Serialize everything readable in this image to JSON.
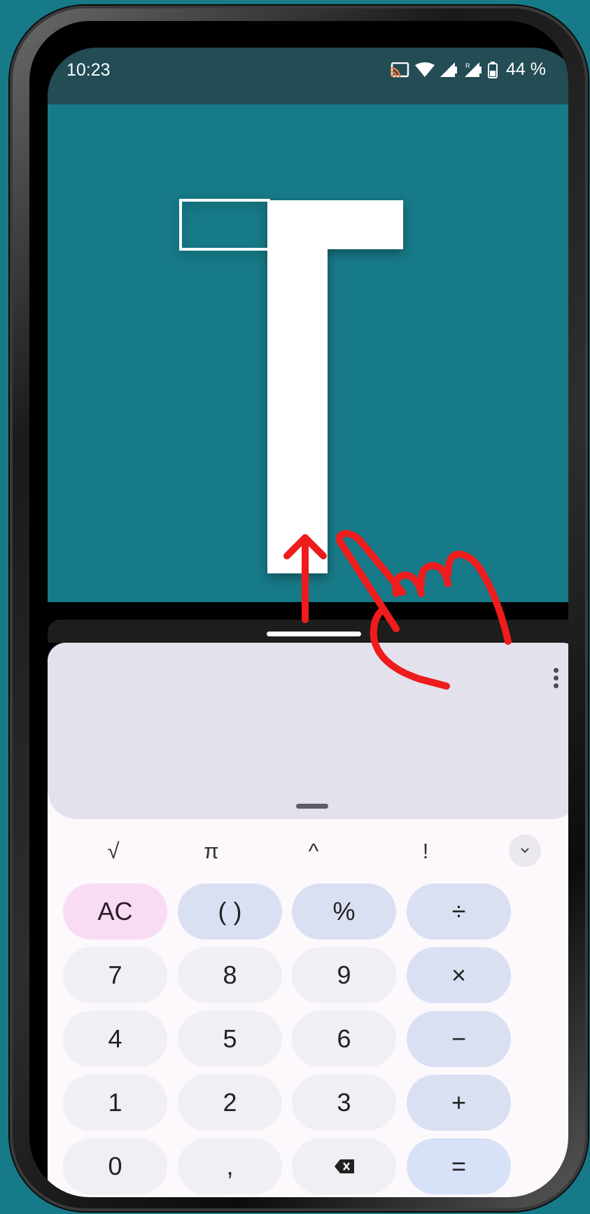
{
  "status_bar": {
    "time": "10:23",
    "battery": "44 %",
    "icons": [
      "cast-icon",
      "wifi-icon",
      "signal-icon",
      "roaming-signal-icon",
      "battery-icon"
    ]
  },
  "top_app": {
    "logo_letter": "T",
    "background_color": "#177a88"
  },
  "calculator": {
    "scientific_keys": [
      "√",
      "π",
      "^",
      "!"
    ],
    "collapse_icon": "chevron-down-icon",
    "more_icon": "more-vertical-icon",
    "keys": [
      [
        "AC",
        "( )",
        "%",
        "÷"
      ],
      [
        "7",
        "8",
        "9",
        "×"
      ],
      [
        "4",
        "5",
        "6",
        "−"
      ],
      [
        "1",
        "2",
        "3",
        "+"
      ],
      [
        "0",
        ",",
        "backspace-icon",
        "="
      ]
    ],
    "colors": {
      "display_bg": "#e3e2ec",
      "key_bg": "#f0eff4",
      "operator_bg": "#d9e0f2",
      "clear_bg": "#f8dcf3"
    }
  },
  "gesture_hint": {
    "type": "swipe-up",
    "icons": [
      "up-arrow-icon",
      "hand-icon"
    ],
    "color": "#ee1c1c"
  }
}
